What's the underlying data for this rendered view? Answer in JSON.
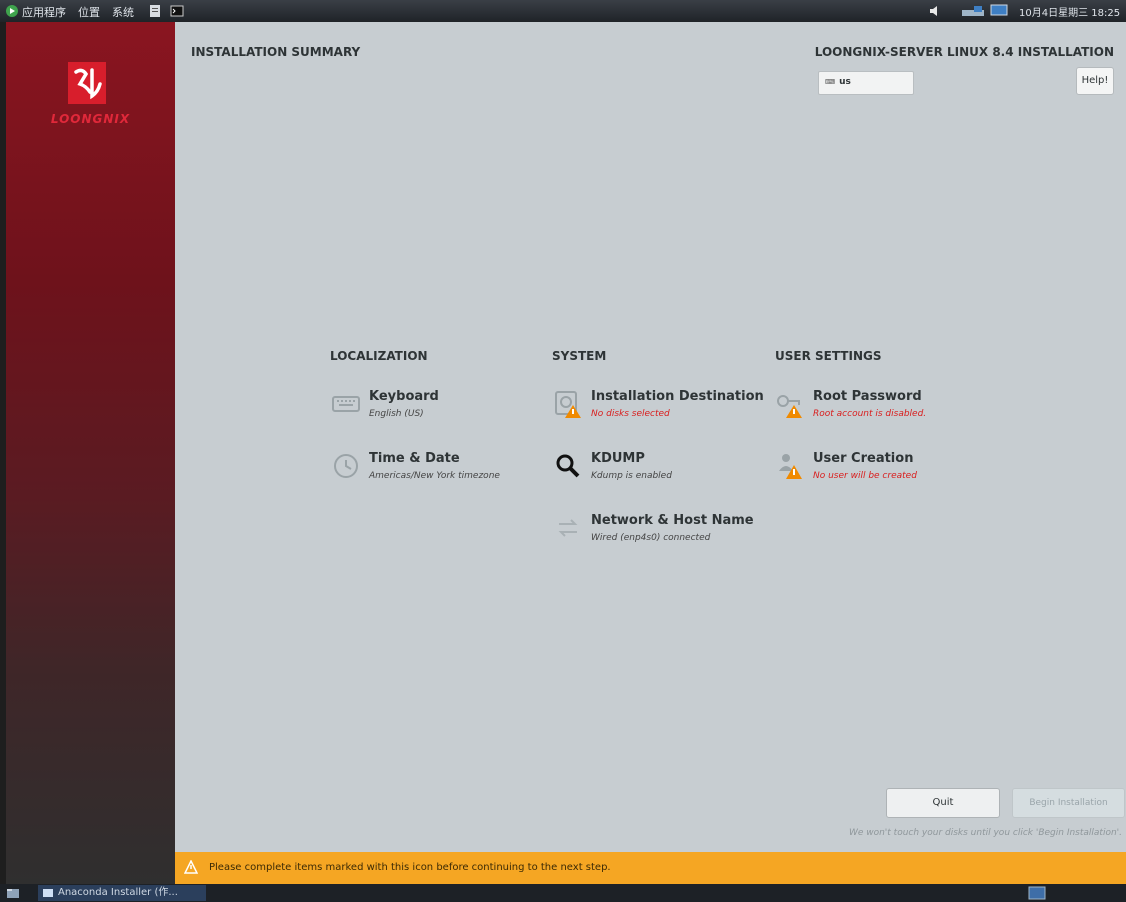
{
  "top_panel": {
    "menus": [
      "应用程序",
      "位置",
      "系统"
    ],
    "clock": "10月4日星期三 18:25"
  },
  "sidebar": {
    "brand": "LOONGNIX",
    "colors": {
      "red": "#8a1520",
      "logo": "#e0283a"
    }
  },
  "header": {
    "page_title": "INSTALLATION SUMMARY",
    "product_title": "LOONGNIX-SERVER LINUX 8.4 INSTALLATION",
    "keyboard_layout": "us",
    "help_label": "Help!"
  },
  "categories": [
    {
      "title": "LOCALIZATION",
      "spokes": [
        {
          "title": "Keyboard",
          "status": "English (US)",
          "warning": false,
          "icon": "keyboard-icon"
        },
        {
          "title": "Time & Date",
          "status": "Americas/New York timezone",
          "warning": false,
          "icon": "clock-icon"
        }
      ]
    },
    {
      "title": "SYSTEM",
      "spokes": [
        {
          "title": "Installation Destination",
          "status": "No disks selected",
          "warning": true,
          "icon": "disk-icon"
        },
        {
          "title": "KDUMP",
          "status": "Kdump is enabled",
          "warning": false,
          "icon": "search-kdump-icon"
        },
        {
          "title": "Network & Host Name",
          "status": "Wired (enp4s0) connected",
          "warning": false,
          "icon": "network-arrows-icon"
        }
      ]
    },
    {
      "title": "USER SETTINGS",
      "spokes": [
        {
          "title": "Root Password",
          "status": "Root account is disabled.",
          "warning": true,
          "icon": "key-icon"
        },
        {
          "title": "User Creation",
          "status": "No user will be created",
          "warning": true,
          "icon": "user-icon"
        }
      ]
    }
  ],
  "actions": {
    "quit_label": "Quit",
    "begin_label": "Begin Installation",
    "footnote": "We won't touch your disks until you click 'Begin Installation'."
  },
  "warning_bar": {
    "text": "Please complete items marked with this icon before continuing to the next step.",
    "color": "#f5a623"
  },
  "taskbar": {
    "app_label": "Anaconda Installer (作..."
  }
}
